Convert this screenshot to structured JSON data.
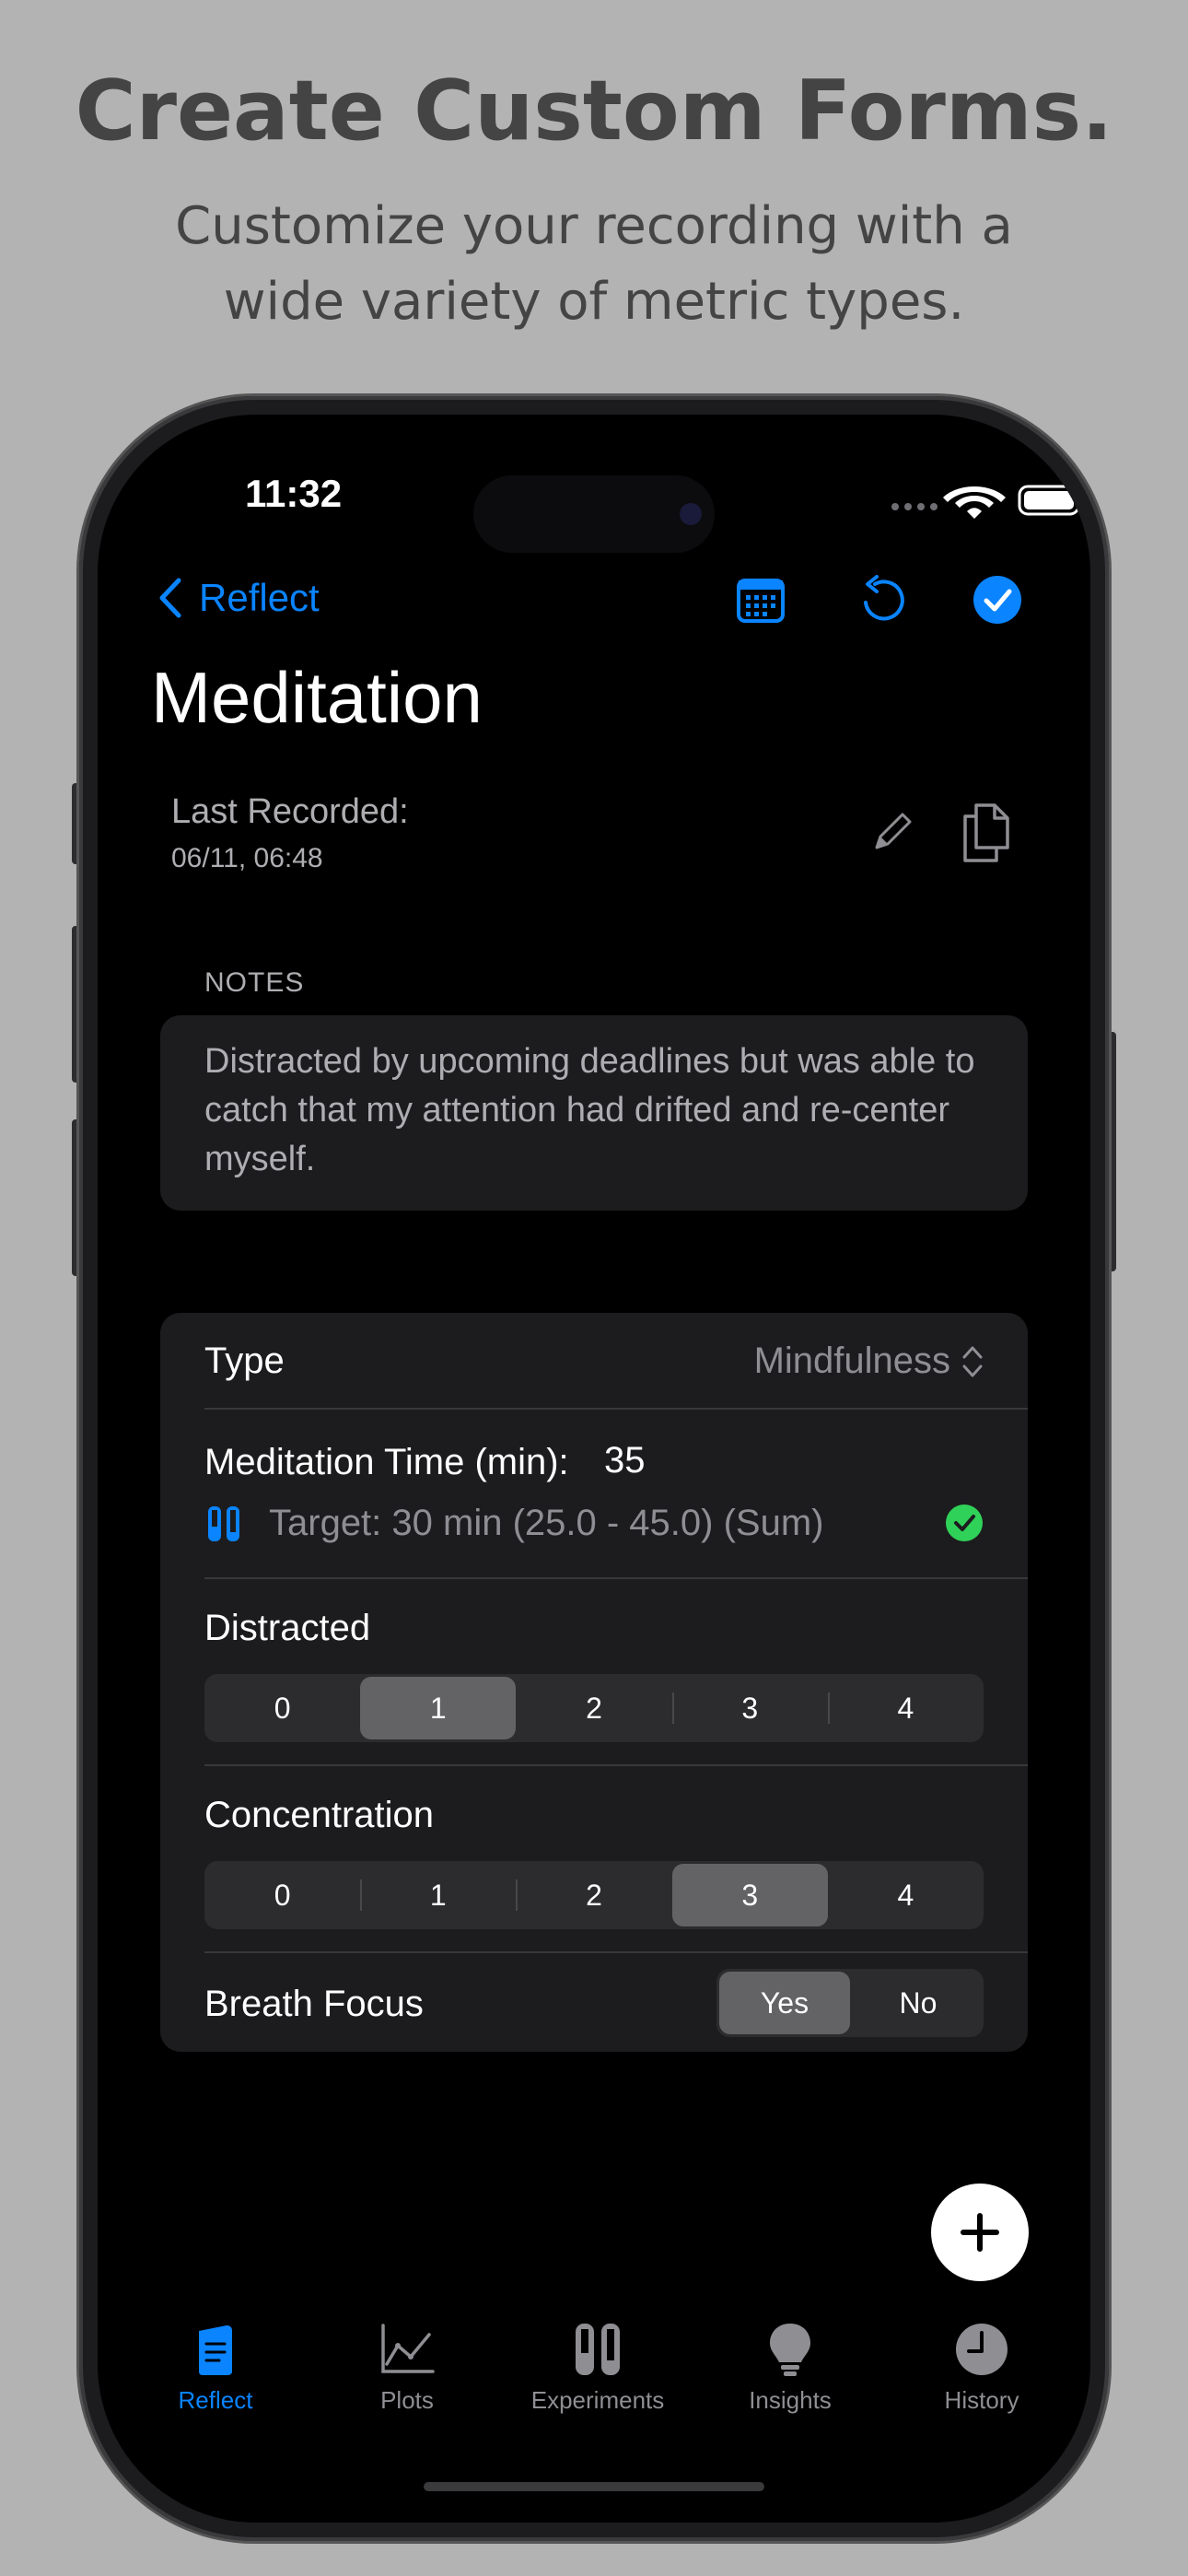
{
  "promo": {
    "headline": "Create Custom Forms.",
    "subline_1": "Customize your recording with a",
    "subline_2": "wide variety of metric types."
  },
  "status_bar": {
    "time": "11:32"
  },
  "nav": {
    "back_label": "Reflect",
    "calendar_icon": "calendar-icon",
    "undo_icon": "undo-icon",
    "confirm_icon": "checkmark-circle-icon"
  },
  "page": {
    "title": "Meditation",
    "last_recorded_label": "Last Recorded:",
    "last_recorded_value": "06/11, 06:48"
  },
  "notes": {
    "section_label": "NOTES",
    "text": "Distracted by upcoming deadlines but was able to catch that my attention had drifted and re-center myself."
  },
  "form": {
    "type_label": "Type",
    "type_value": "Mindfulness",
    "meditation_label": "Meditation Time (min):",
    "meditation_value": "35",
    "target_text": "Target: 30 min (25.0 - 45.0) (Sum)",
    "distracted_label": "Distracted",
    "distracted_options": [
      "0",
      "1",
      "2",
      "3",
      "4"
    ],
    "distracted_selected": "1",
    "concentration_label": "Concentration",
    "concentration_options": [
      "0",
      "1",
      "2",
      "3",
      "4"
    ],
    "concentration_selected": "3",
    "breath_label": "Breath Focus",
    "breath_yes": "Yes",
    "breath_no": "No",
    "breath_selected": "Yes"
  },
  "tabs": [
    {
      "label": "Reflect",
      "icon": "reflect-icon",
      "active": true
    },
    {
      "label": "Plots",
      "icon": "plots-icon",
      "active": false
    },
    {
      "label": "Experiments",
      "icon": "experiments-icon",
      "active": false
    },
    {
      "label": "Insights",
      "icon": "insights-icon",
      "active": false
    },
    {
      "label": "History",
      "icon": "history-icon",
      "active": false
    }
  ],
  "colors": {
    "accent": "#0a84ff",
    "success": "#30d158",
    "background": "#000000",
    "card": "#1c1c1e"
  }
}
